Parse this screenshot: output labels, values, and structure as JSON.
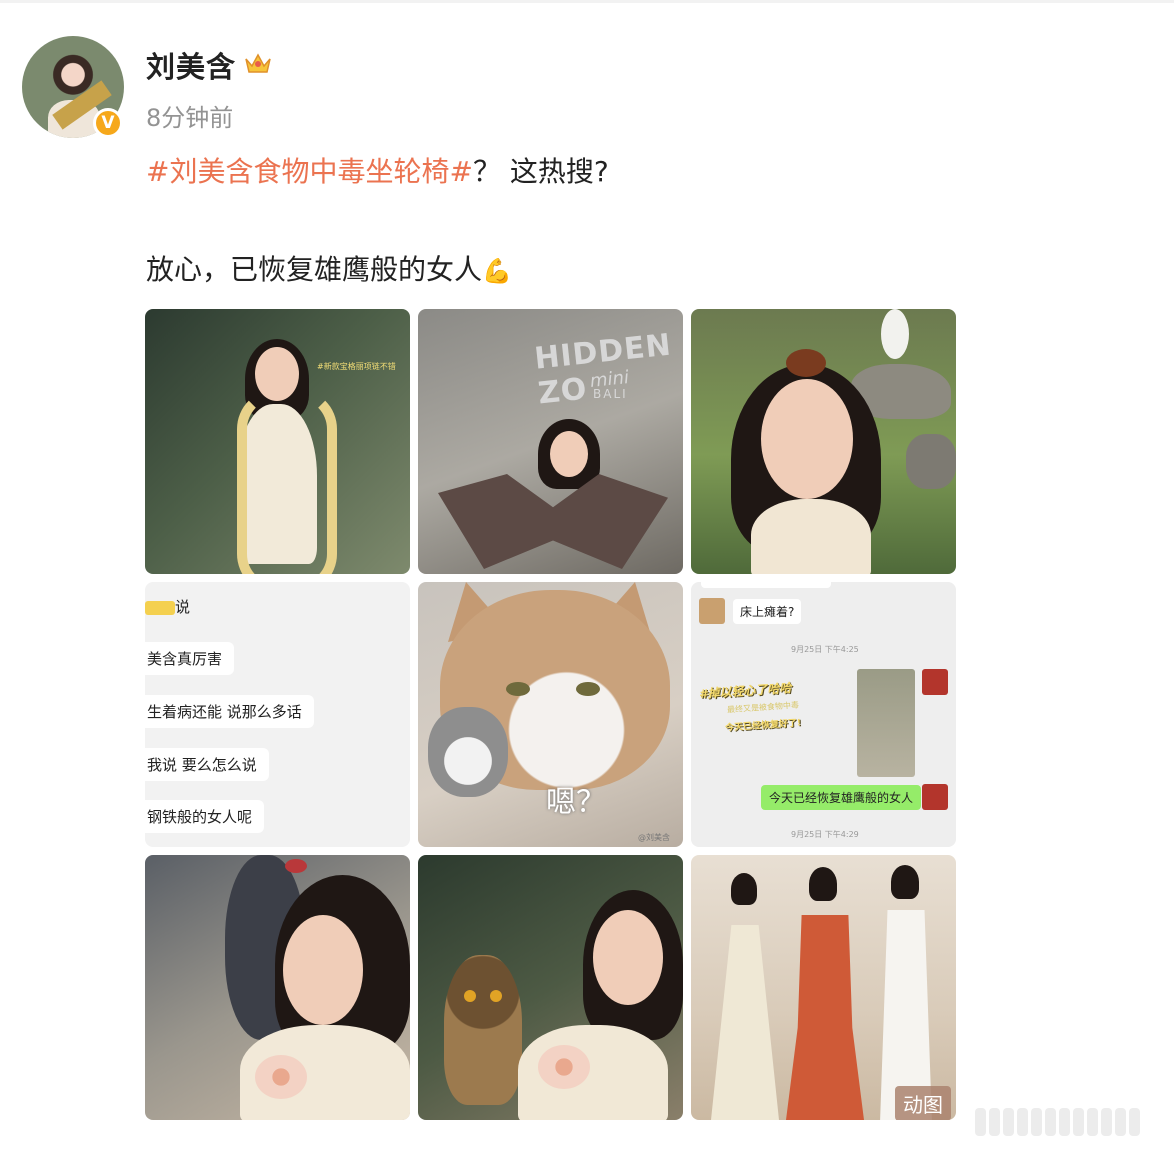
{
  "post": {
    "author": "刘美含",
    "time": "8分钟前",
    "hashtag": "#刘美含食物中毒坐轮椅#",
    "line1_rest": "？ 这热搜?",
    "line2": "放心，已恢复雄鹰般的女人",
    "emoji": "💪",
    "verified_mark": "V"
  },
  "images": {
    "snake_note": "#新款宝格丽项链不错",
    "zoo_sign_1": "HIDDEN ZO",
    "zoo_sign_2": "mini",
    "zoo_sign_3": "BALI",
    "chat_title": "说",
    "chat_lines": [
      "美含真厉害",
      "生着病还能 说那么多话",
      "我说 要么怎么说",
      "钢铁般的女人呢"
    ],
    "cat_caption": "嗯？",
    "cat_watermark": "@刘美含",
    "wechat": {
      "question": "床上瘫着?",
      "time1": "9月25日 下午4:25",
      "sticker_1": "#掉以轻心了哈哈",
      "sticker_2": "最终又是被食物中毒",
      "sticker_3": "今天已经恢复好了!",
      "reply": "今天已经恢复雄鹰般的女人",
      "time2": "9月25日 下午4:29"
    },
    "gif_badge": "动图"
  },
  "colors": {
    "hashtag": "#eb7350",
    "username": "#222222",
    "timestamp": "#939393",
    "badge": "#f6a81b"
  }
}
